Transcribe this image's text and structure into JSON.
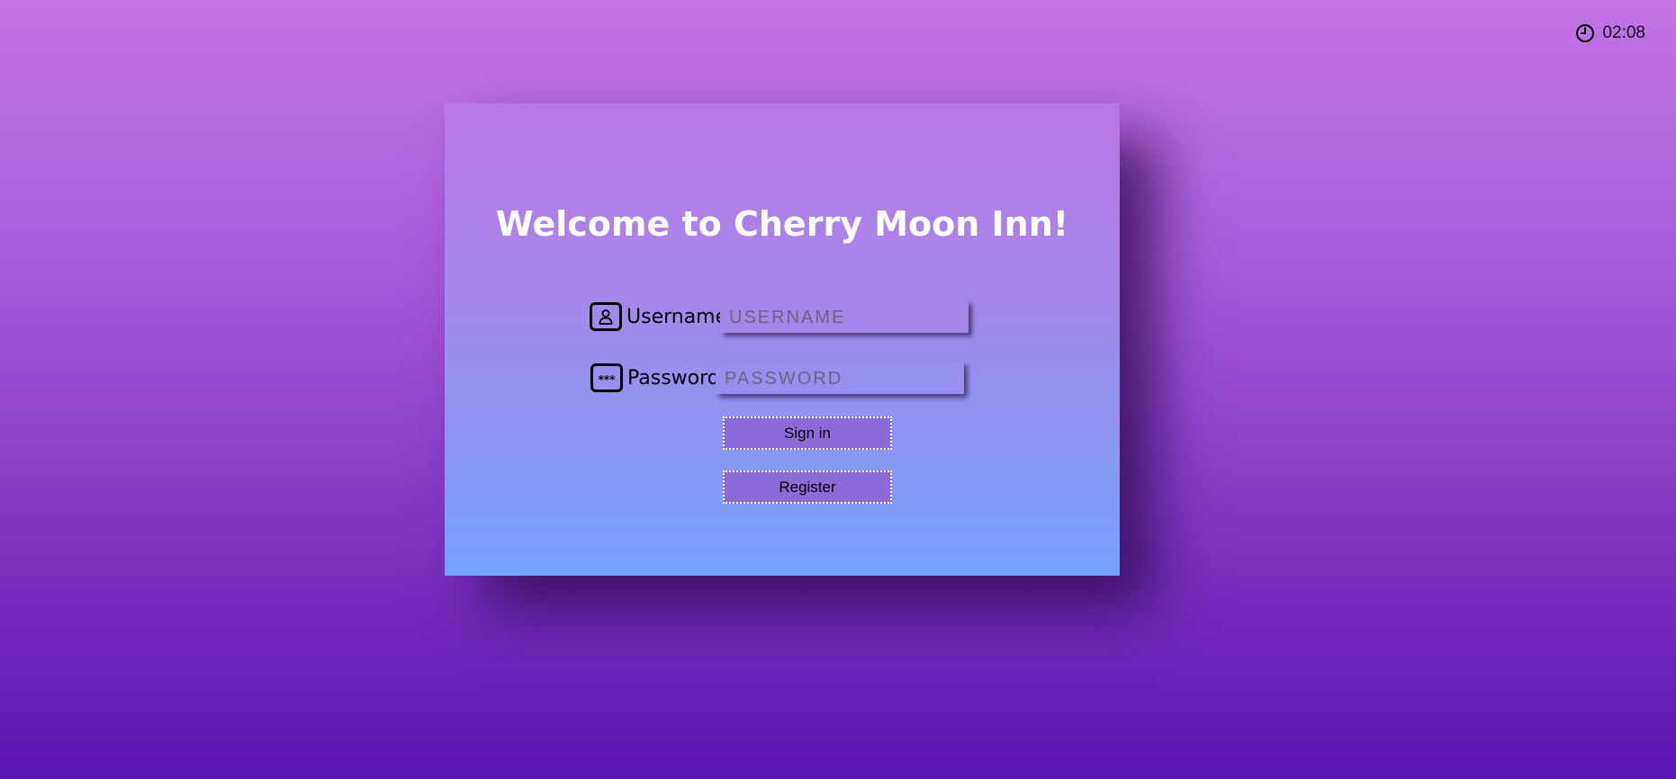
{
  "clock": {
    "icon": "clock-icon",
    "time": "02:08"
  },
  "login": {
    "title": "Welcome to Cherry Moon Inn!",
    "username": {
      "icon": "user-icon",
      "label": "Username",
      "placeholder": "USERNAME",
      "value": ""
    },
    "password": {
      "icon": "password-icon",
      "icon_text": "***",
      "label": "Password",
      "placeholder": "PASSWORD",
      "value": ""
    },
    "sign_in_label": "Sign in",
    "register_label": "Register"
  },
  "colors": {
    "background_top": "#c274e4",
    "background_bottom": "#5a14b0",
    "card_top": "#bb77e6",
    "card_bottom": "#74a2fb",
    "button_fill": "#8a6bd8",
    "title_text": "#ffffff"
  }
}
